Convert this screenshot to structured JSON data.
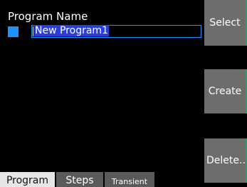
{
  "program": {
    "field_label": "Program Name",
    "name_value": "New Program1"
  },
  "side_buttons": {
    "select": "Select",
    "create": "Create",
    "delete": "Delete.."
  },
  "tabs": [
    {
      "label": "Program",
      "active": true
    },
    {
      "label": "Steps",
      "active": false
    },
    {
      "label": "Transient",
      "active": false
    }
  ],
  "colors": {
    "background": "#000000",
    "selection_blue": "#1e90ff",
    "highlight": "#2b3fd6",
    "button_gray": "#6d6d6d",
    "button_accent": "#1aa36e",
    "tab_active": "#e6e6e6",
    "tab_inactive": "#5a5a5a"
  }
}
